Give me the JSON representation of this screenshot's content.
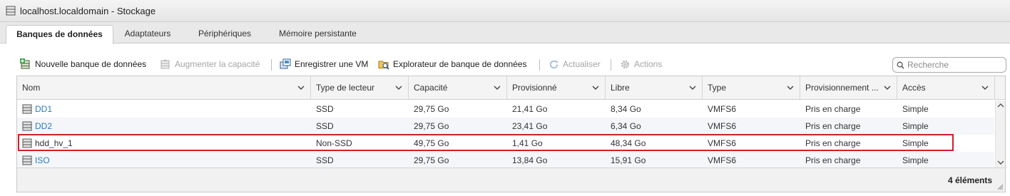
{
  "window": {
    "title": "localhost.localdomain - Stockage",
    "icon": "storage-icon"
  },
  "tabs": [
    {
      "label": "Banques de données",
      "active": true
    },
    {
      "label": "Adaptateurs",
      "active": false
    },
    {
      "label": "Périphériques",
      "active": false
    },
    {
      "label": "Mémoire persistante",
      "active": false
    }
  ],
  "toolbar": {
    "new_datastore": "Nouvelle banque de données",
    "increase_capacity": "Augmenter la capacité",
    "register_vm": "Enregistrer une VM",
    "datastore_browser": "Explorateur de banque de données",
    "refresh": "Actualiser",
    "actions": "Actions"
  },
  "search": {
    "placeholder": "Recherche"
  },
  "table": {
    "columns": [
      "Nom",
      "Type de lecteur",
      "Capacité",
      "Provisionné",
      "Libre",
      "Type",
      "Provisionnement ...",
      "Accès"
    ],
    "rows": [
      {
        "name": "DD1",
        "drive_type": "SSD",
        "capacity": "29,75 Go",
        "provisioned": "21,41 Go",
        "free": "8,34 Go",
        "type": "VMFS6",
        "provisioning": "Pris en charge",
        "access": "Simple",
        "link": true
      },
      {
        "name": "DD2",
        "drive_type": "SSD",
        "capacity": "29,75 Go",
        "provisioned": "23,41 Go",
        "free": "6,34 Go",
        "type": "VMFS6",
        "provisioning": "Pris en charge",
        "access": "Simple",
        "link": true
      },
      {
        "name": "hdd_hv_1",
        "drive_type": "Non-SSD",
        "capacity": "49,75 Go",
        "provisioned": "1,41 Go",
        "free": "48,34 Go",
        "type": "VMFS6",
        "provisioning": "Pris en charge",
        "access": "Simple",
        "link": false
      },
      {
        "name": "ISO",
        "drive_type": "SSD",
        "capacity": "29,75 Go",
        "provisioned": "13,84 Go",
        "free": "15,91 Go",
        "type": "VMFS6",
        "provisioning": "Pris en charge",
        "access": "Simple",
        "link": true
      }
    ],
    "footer_count": "4 éléments"
  },
  "colors": {
    "link": "#2c7bbd",
    "highlight": "#d01f2a",
    "header_bg": "#f4f4f4",
    "alt_row": "#f4f6f9"
  }
}
